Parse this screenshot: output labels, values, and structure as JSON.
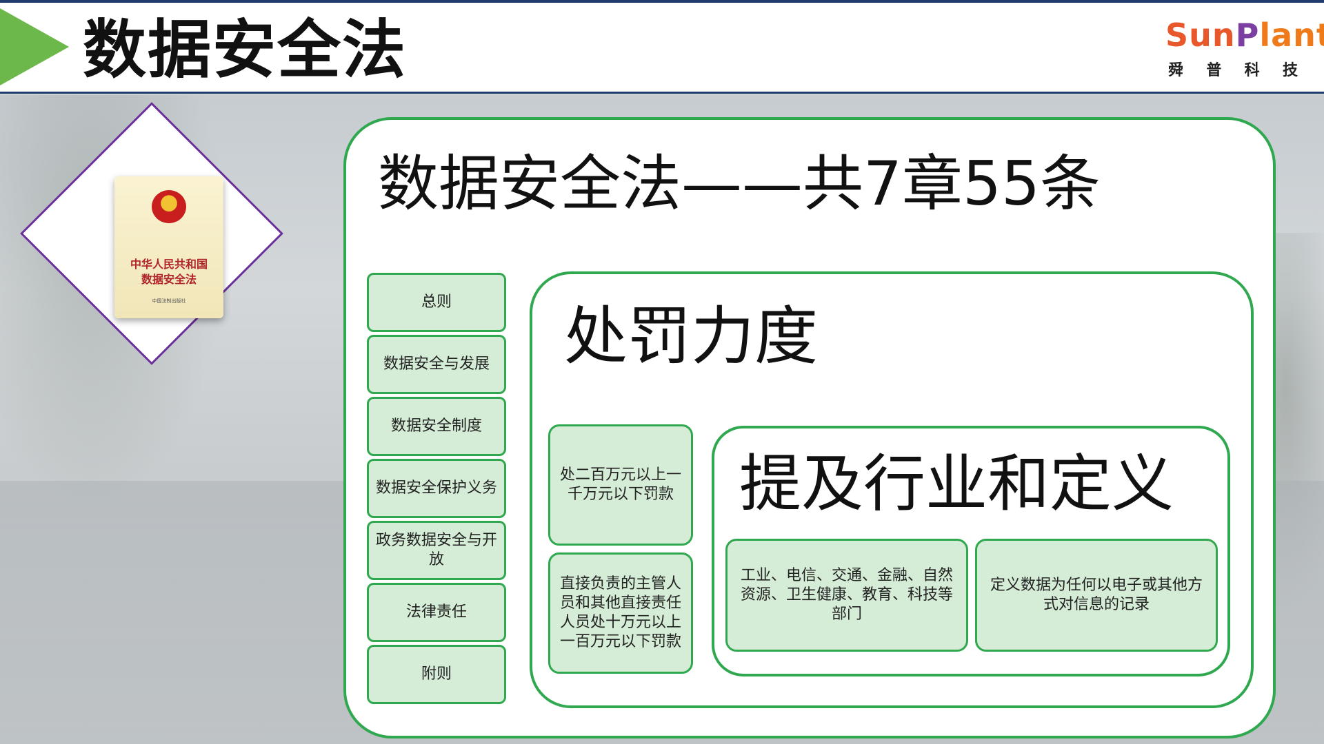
{
  "header": {
    "title": "数据安全法"
  },
  "logo": {
    "text_s": "S",
    "text_un": "un",
    "text_p": "P",
    "text_lant": "lant",
    "cn": [
      "舜",
      "普",
      "科",
      "技"
    ]
  },
  "book": {
    "title_line1": "中华人民共和国",
    "title_line2": "数据安全法",
    "publisher": "中国法制出版社"
  },
  "main": {
    "title": "数据安全法——共7章55条",
    "chapters": [
      "总则",
      "数据安全与发展",
      "数据安全制度",
      "数据安全保护义务",
      "政务数据安全与开放",
      "法律责任",
      "附则"
    ]
  },
  "penalty": {
    "title": "处罚力度",
    "items": [
      "处二百万元以上一千万元以下罚款",
      "直接负责的主管人员和其他直接责任人员处十万元以上一百万元以下罚款"
    ]
  },
  "scope": {
    "title": "提及行业和定义",
    "industries": "工业、电信、交通、金融、自然资源、卫生健康、教育、科技等部门",
    "definition": "定义数据为任何以电子或其他方式对信息的记录"
  },
  "colors": {
    "accent_green": "#2fa84f",
    "box_fill": "#d5ecd6",
    "header_arrow": "#6cb84a",
    "diamond_border": "#6a2f9a",
    "header_line": "#1f3b6e"
  }
}
